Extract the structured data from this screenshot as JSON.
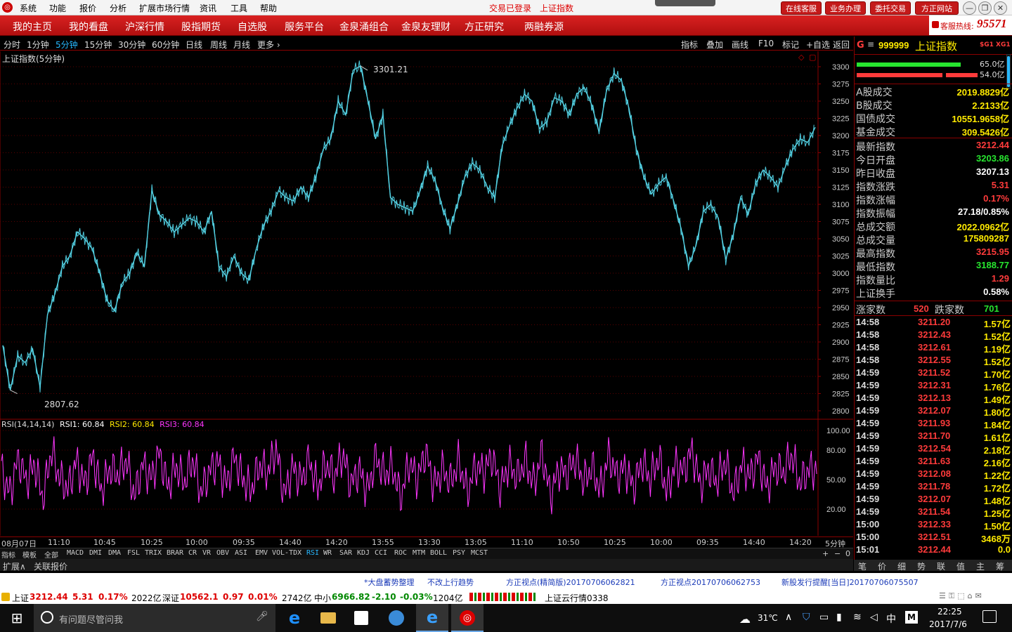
{
  "menubar": {
    "items": [
      "系统",
      "功能",
      "报价",
      "分析",
      "扩展市场行情",
      "资讯",
      "工具",
      "帮助"
    ],
    "status_login": "交易已登录",
    "status_index": "上证指数",
    "buttons": [
      "在线客服",
      "业务办理",
      "委托交易",
      "方正网站"
    ]
  },
  "navbar": {
    "items": [
      "我的主页",
      "我的看盘",
      "沪深行情",
      "股指期货",
      "自选股",
      "服务平台",
      "金泉涌组合",
      "金泉友理财",
      "方正研究",
      "两融券源"
    ],
    "hotline_label": "客服热线:",
    "hotline_number": "95571"
  },
  "periodbar": {
    "periods": [
      "分时",
      "1分钟",
      "5分钟",
      "15分钟",
      "30分钟",
      "60分钟",
      "日线",
      "周线",
      "月线",
      "更多 ›"
    ],
    "active_index": 2,
    "tools": [
      "指标",
      "叠加",
      "画线",
      "F10",
      "标记",
      "+自选",
      "返回"
    ]
  },
  "chart": {
    "title": "上证指数(5分钟)",
    "high_label": "3301.21",
    "low_label": "2807.62",
    "rsi_title": "RSI(14,14,14)",
    "rsi1": "RSI1: 60.84",
    "rsi2": "RSI2: 60.84",
    "rsi3": "RSI3: 60.84",
    "period_tag": "5分钟"
  },
  "chart_data": {
    "type": "line",
    "series": [
      {
        "values": [
          2895,
          2830,
          2880,
          2870,
          2890,
          2835,
          2940,
          2970,
          3010,
          3025,
          3060,
          3050,
          3035,
          3000,
          2960,
          2945,
          2985,
          3000,
          3030,
          3010,
          3120,
          3085,
          3075,
          3060,
          3070,
          3080,
          3075,
          3060,
          3090,
          3010,
          2995,
          3025,
          3000,
          2990,
          3035,
          3070,
          3090,
          3120,
          3110,
          3105,
          3125,
          3110,
          3140,
          3180,
          3195,
          3250,
          3230,
          3295,
          3301,
          3250,
          3195,
          3230,
          3110,
          3100,
          3095,
          3090,
          3120,
          3155,
          3135,
          3095,
          3065,
          3100,
          3140,
          3160,
          3150,
          3125,
          3110,
          3185,
          3215,
          3240,
          3260,
          3250,
          3210,
          3220,
          3255,
          3250,
          3230,
          3260,
          3270,
          3245,
          3205,
          3265,
          3290,
          3280,
          3240,
          3180,
          3140,
          3115,
          3130,
          3140,
          3105,
          3065,
          3010,
          3040,
          3090,
          3100,
          3080,
          3020,
          3055,
          3110,
          3085,
          3130,
          3150,
          3140,
          3125,
          3155,
          3180,
          3195,
          3190,
          3212
        ]
      }
    ],
    "rsi_values": [
      60,
      35,
      72,
      48,
      66,
      30,
      80,
      52,
      40,
      69,
      45,
      74,
      38,
      61,
      55,
      70,
      33,
      66,
      50,
      78,
      42,
      64,
      47,
      71,
      36,
      59,
      68,
      44,
      73,
      51,
      39,
      65,
      57,
      82,
      34,
      62,
      49,
      70,
      41,
      67,
      53,
      76,
      45,
      60,
      38,
      72,
      55,
      63,
      31,
      68,
      50,
      79,
      43,
      61,
      47,
      70,
      36,
      64,
      58,
      74,
      40,
      66,
      52,
      69,
      45,
      77,
      33,
      60,
      56,
      71,
      48,
      63,
      39,
      75,
      54,
      62,
      42,
      68,
      50,
      73,
      37,
      65,
      58,
      80,
      44,
      61,
      47,
      70,
      35,
      66,
      53,
      72,
      41,
      63,
      57,
      76,
      46,
      60,
      60
    ]
  },
  "price_axis": [
    "3300",
    "3275",
    "3250",
    "3225",
    "3200",
    "3175",
    "3150",
    "3125",
    "3100",
    "3075",
    "3050",
    "3025",
    "3000",
    "2975",
    "2950",
    "2925",
    "2900",
    "2875",
    "2850",
    "2825",
    "2800"
  ],
  "rsi_axis": [
    "100.00",
    "80.00",
    "50.00",
    "20.00"
  ],
  "time_axis": [
    "08月07日",
    "11:10",
    "10:45",
    "10:25",
    "10:00",
    "09:35",
    "14:40",
    "14:20",
    "13:55",
    "13:30",
    "13:05",
    "11:10",
    "10:50",
    "10:25",
    "10:00",
    "09:35",
    "14:40",
    "14:20"
  ],
  "indicators": [
    "指标",
    "模板",
    "全部",
    "MACD",
    "DMI",
    "DMA",
    "FSL",
    "TRIX",
    "BRAR",
    "CR",
    "VR",
    "OBV",
    "ASI",
    "EMV",
    "VOL-TDX",
    "RSI",
    "WR",
    "SAR",
    "KDJ",
    "CCI",
    "ROC",
    "MTM",
    "BOLL",
    "PSY",
    "MCST"
  ],
  "active_indicator": "RSI",
  "ext_tabs": [
    "扩展∧",
    "关联报价"
  ],
  "right": {
    "code": "999999",
    "name": "上证指数",
    "bar_up": "65.0亿",
    "bar_down": "54.0亿",
    "stats": [
      {
        "label": "A股成交",
        "value": "2019.8829亿",
        "color": "yellow"
      },
      {
        "label": "B股成交",
        "value": "2.2133亿",
        "color": "yellow"
      },
      {
        "label": "国债成交",
        "value": "10551.9658亿",
        "color": "yellow"
      },
      {
        "label": "基金成交",
        "value": "309.5426亿",
        "color": "yellow"
      }
    ],
    "quote": [
      {
        "label": "最新指数",
        "value": "3212.44",
        "color": "red"
      },
      {
        "label": "今日开盘",
        "value": "3203.86",
        "color": "green"
      },
      {
        "label": "昨日收盘",
        "value": "3207.13",
        "color": "white"
      },
      {
        "label": "指数涨跌",
        "value": "5.31",
        "color": "red"
      },
      {
        "label": "指数涨幅",
        "value": "0.17%",
        "color": "red"
      },
      {
        "label": "指数振幅",
        "value": "27.18/0.85%",
        "color": "white"
      },
      {
        "label": "总成交额",
        "value": "2022.0962亿",
        "color": "yellow"
      },
      {
        "label": "总成交量",
        "value": "175809287",
        "color": "yellow"
      },
      {
        "label": "最高指数",
        "value": "3215.95",
        "color": "red"
      },
      {
        "label": "最低指数",
        "value": "3188.77",
        "color": "green"
      },
      {
        "label": "指数量比",
        "value": "1.29",
        "color": "red"
      },
      {
        "label": "上证换手",
        "value": "0.58%",
        "color": "white"
      }
    ],
    "up_label": "涨家数",
    "up_count": "520",
    "down_label": "跌家数",
    "down_count": "701",
    "ticks": [
      {
        "time": "14:58",
        "price": "3211.20",
        "vol": "1.57亿"
      },
      {
        "time": "14:58",
        "price": "3212.43",
        "vol": "1.52亿"
      },
      {
        "time": "14:58",
        "price": "3212.61",
        "vol": "1.19亿"
      },
      {
        "time": "14:58",
        "price": "3212.55",
        "vol": "1.52亿"
      },
      {
        "time": "14:59",
        "price": "3211.52",
        "vol": "1.70亿"
      },
      {
        "time": "14:59",
        "price": "3212.31",
        "vol": "1.76亿"
      },
      {
        "time": "14:59",
        "price": "3212.13",
        "vol": "1.49亿"
      },
      {
        "time": "14:59",
        "price": "3212.07",
        "vol": "1.80亿"
      },
      {
        "time": "14:59",
        "price": "3211.93",
        "vol": "1.84亿"
      },
      {
        "time": "14:59",
        "price": "3211.70",
        "vol": "1.61亿"
      },
      {
        "time": "14:59",
        "price": "3212.54",
        "vol": "2.18亿"
      },
      {
        "time": "14:59",
        "price": "3211.63",
        "vol": "2.16亿"
      },
      {
        "time": "14:59",
        "price": "3212.08",
        "vol": "1.22亿"
      },
      {
        "time": "14:59",
        "price": "3211.78",
        "vol": "1.72亿"
      },
      {
        "time": "14:59",
        "price": "3212.07",
        "vol": "1.48亿"
      },
      {
        "time": "14:59",
        "price": "3211.54",
        "vol": "1.25亿"
      },
      {
        "time": "15:00",
        "price": "3212.33",
        "vol": "1.50亿"
      },
      {
        "time": "15:00",
        "price": "3212.51",
        "vol": "3468万"
      },
      {
        "time": "15:01",
        "price": "3212.44",
        "vol": "0.0"
      }
    ],
    "tabs": [
      "笔",
      "价",
      "细",
      "势",
      "联",
      "值",
      "主",
      "筹"
    ]
  },
  "news": [
    "*大盘蓄势整理",
    "不改上行趋势",
    "方正视点(精简版)20170706062821",
    "方正视点20170706062753",
    "新股发行提醒[当日]20170706075507"
  ],
  "status": {
    "sh_label": "上证",
    "sh_value": "3212.44",
    "sh_change": "5.31",
    "sh_pct": "0.17%",
    "sh_amount": "2022亿",
    "sz_label": "深证",
    "sz_value": "10562.1",
    "sz_change": "0.97",
    "sz_pct": "0.01%",
    "sz_amount": "2742亿",
    "zx_label": "中小",
    "zx_value": "6966.82",
    "zx_change": "-2.10",
    "zx_pct": "-0.03%",
    "zx_amount": "1204亿",
    "cloud": "上证云行情0338"
  },
  "taskbar": {
    "search_placeholder": "有问题尽管问我",
    "weather": "31℃",
    "ime": "中",
    "time": "22:25",
    "date": "2017/7/6"
  }
}
